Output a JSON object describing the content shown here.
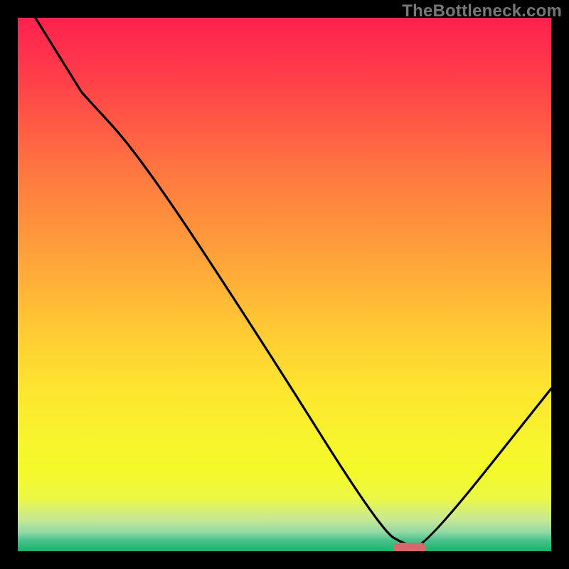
{
  "watermark": "TheBottleneck.com",
  "colors": {
    "frame": "#000000",
    "curve": "#000000",
    "marker": "#d66a6a",
    "watermark_text": "#777777"
  },
  "chart_data": {
    "type": "line",
    "title": "",
    "xlabel": "",
    "ylabel": "",
    "xlim": [
      0,
      100
    ],
    "ylim": [
      0,
      100
    ],
    "x": [
      3.3,
      12.0,
      23.0,
      45.0,
      68.0,
      73.0,
      76.5,
      100.0
    ],
    "y": [
      100.0,
      86.0,
      74.0,
      40.6,
      4.0,
      1.0,
      1.0,
      30.5
    ],
    "series_name": "bottleneck curve",
    "marker": {
      "x_pct": 73.5,
      "y_pct": 0.5
    },
    "notes": "No axis ticks/labels visible. Values read as percentages of the plot frame."
  }
}
